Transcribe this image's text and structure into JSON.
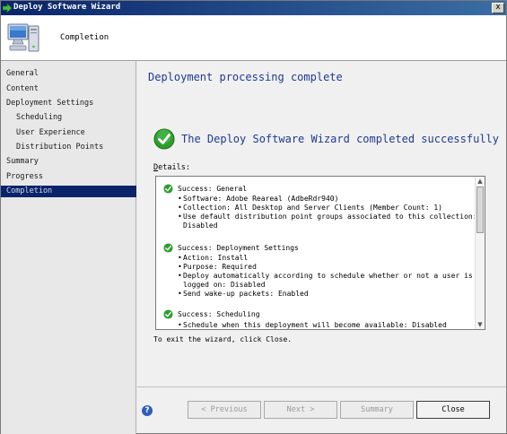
{
  "window": {
    "title": "Deploy Software Wizard",
    "close_glyph": "x"
  },
  "header": {
    "page_title": "Completion",
    "icon": "computer-icon"
  },
  "sidebar": {
    "items": [
      {
        "label": "General",
        "indent": 0,
        "selected": false
      },
      {
        "label": "Content",
        "indent": 0,
        "selected": false
      },
      {
        "label": "Deployment Settings",
        "indent": 0,
        "selected": false
      },
      {
        "label": "Scheduling",
        "indent": 1,
        "selected": false
      },
      {
        "label": "User Experience",
        "indent": 1,
        "selected": false
      },
      {
        "label": "Distribution Points",
        "indent": 1,
        "selected": false
      },
      {
        "label": "Summary",
        "indent": 0,
        "selected": false
      },
      {
        "label": "Progress",
        "indent": 0,
        "selected": false
      },
      {
        "label": "Completion",
        "indent": 0,
        "selected": true
      }
    ]
  },
  "main": {
    "heading": "Deployment processing complete",
    "success_message": "The Deploy Software Wizard completed successfully",
    "details_label": "Details:",
    "details_access_key": "D",
    "details_label_rest": "etails:",
    "sections": [
      {
        "title": "Success: General",
        "bullets": [
          "Software: Adobe Reareal (AdbeRdr940)",
          "Collection: All Desktop and Server Clients (Member Count: 1)",
          "Use default distribution point groups associated to this collection:",
          "Disabled"
        ]
      },
      {
        "title": "Success: Deployment Settings",
        "bullets": [
          "Action: Install",
          "Purpose: Required",
          "Deploy automatically according to schedule whether or not a user is",
          "logged on: Disabled",
          "Send wake-up packets: Enabled"
        ]
      },
      {
        "title": "Success: Scheduling",
        "bullets": [
          "Schedule when this deployment will become available: Disabled"
        ]
      }
    ],
    "exit_text": "To exit the wizard, click Close."
  },
  "footer": {
    "help_glyph": "?",
    "previous_label": "< Previous",
    "next_label": "Next >",
    "summary_label": "Summary",
    "close_label": "Close"
  },
  "colors": {
    "heading_blue": "#1f3a93",
    "selection": "#0a246a",
    "success_green": "#2e9e2e"
  }
}
